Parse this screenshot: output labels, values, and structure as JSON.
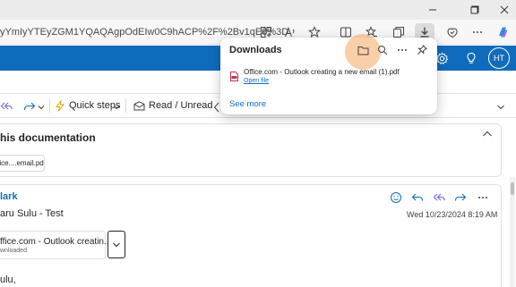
{
  "browser": {
    "url_fragment": "yYmIyYTEyZGM1YQAQAgpOdEIw0C9hACP%2F%2Bv1qE8%3D",
    "window_controls": [
      "minimize",
      "maximize",
      "close"
    ]
  },
  "outlook_header": {
    "avatar_initials": "HT"
  },
  "toolbar": {
    "quick_steps_label": "Quick steps",
    "read_unread_label": "Read / Unread"
  },
  "email_thread": {
    "subject": "his documentation",
    "attachment_chip": "ffice....email.pdf"
  },
  "message": {
    "sender": "lark",
    "to_line": "aru Sulu - Test",
    "date": "Wed 10/23/2024 8:19 AM",
    "attachment_name": "ffice.com - Outlook creatin...",
    "attachment_status": "wnloaded",
    "greeting": "ulu,"
  },
  "downloads_panel": {
    "title": "Downloads",
    "file_name": "Office.com - Outlook creating a new email (1).pdf",
    "open_file_label": "Open file",
    "see_more_label": "See more"
  },
  "colors": {
    "brand_blue": "#0f6cbd",
    "highlight": "#f6a55f"
  }
}
